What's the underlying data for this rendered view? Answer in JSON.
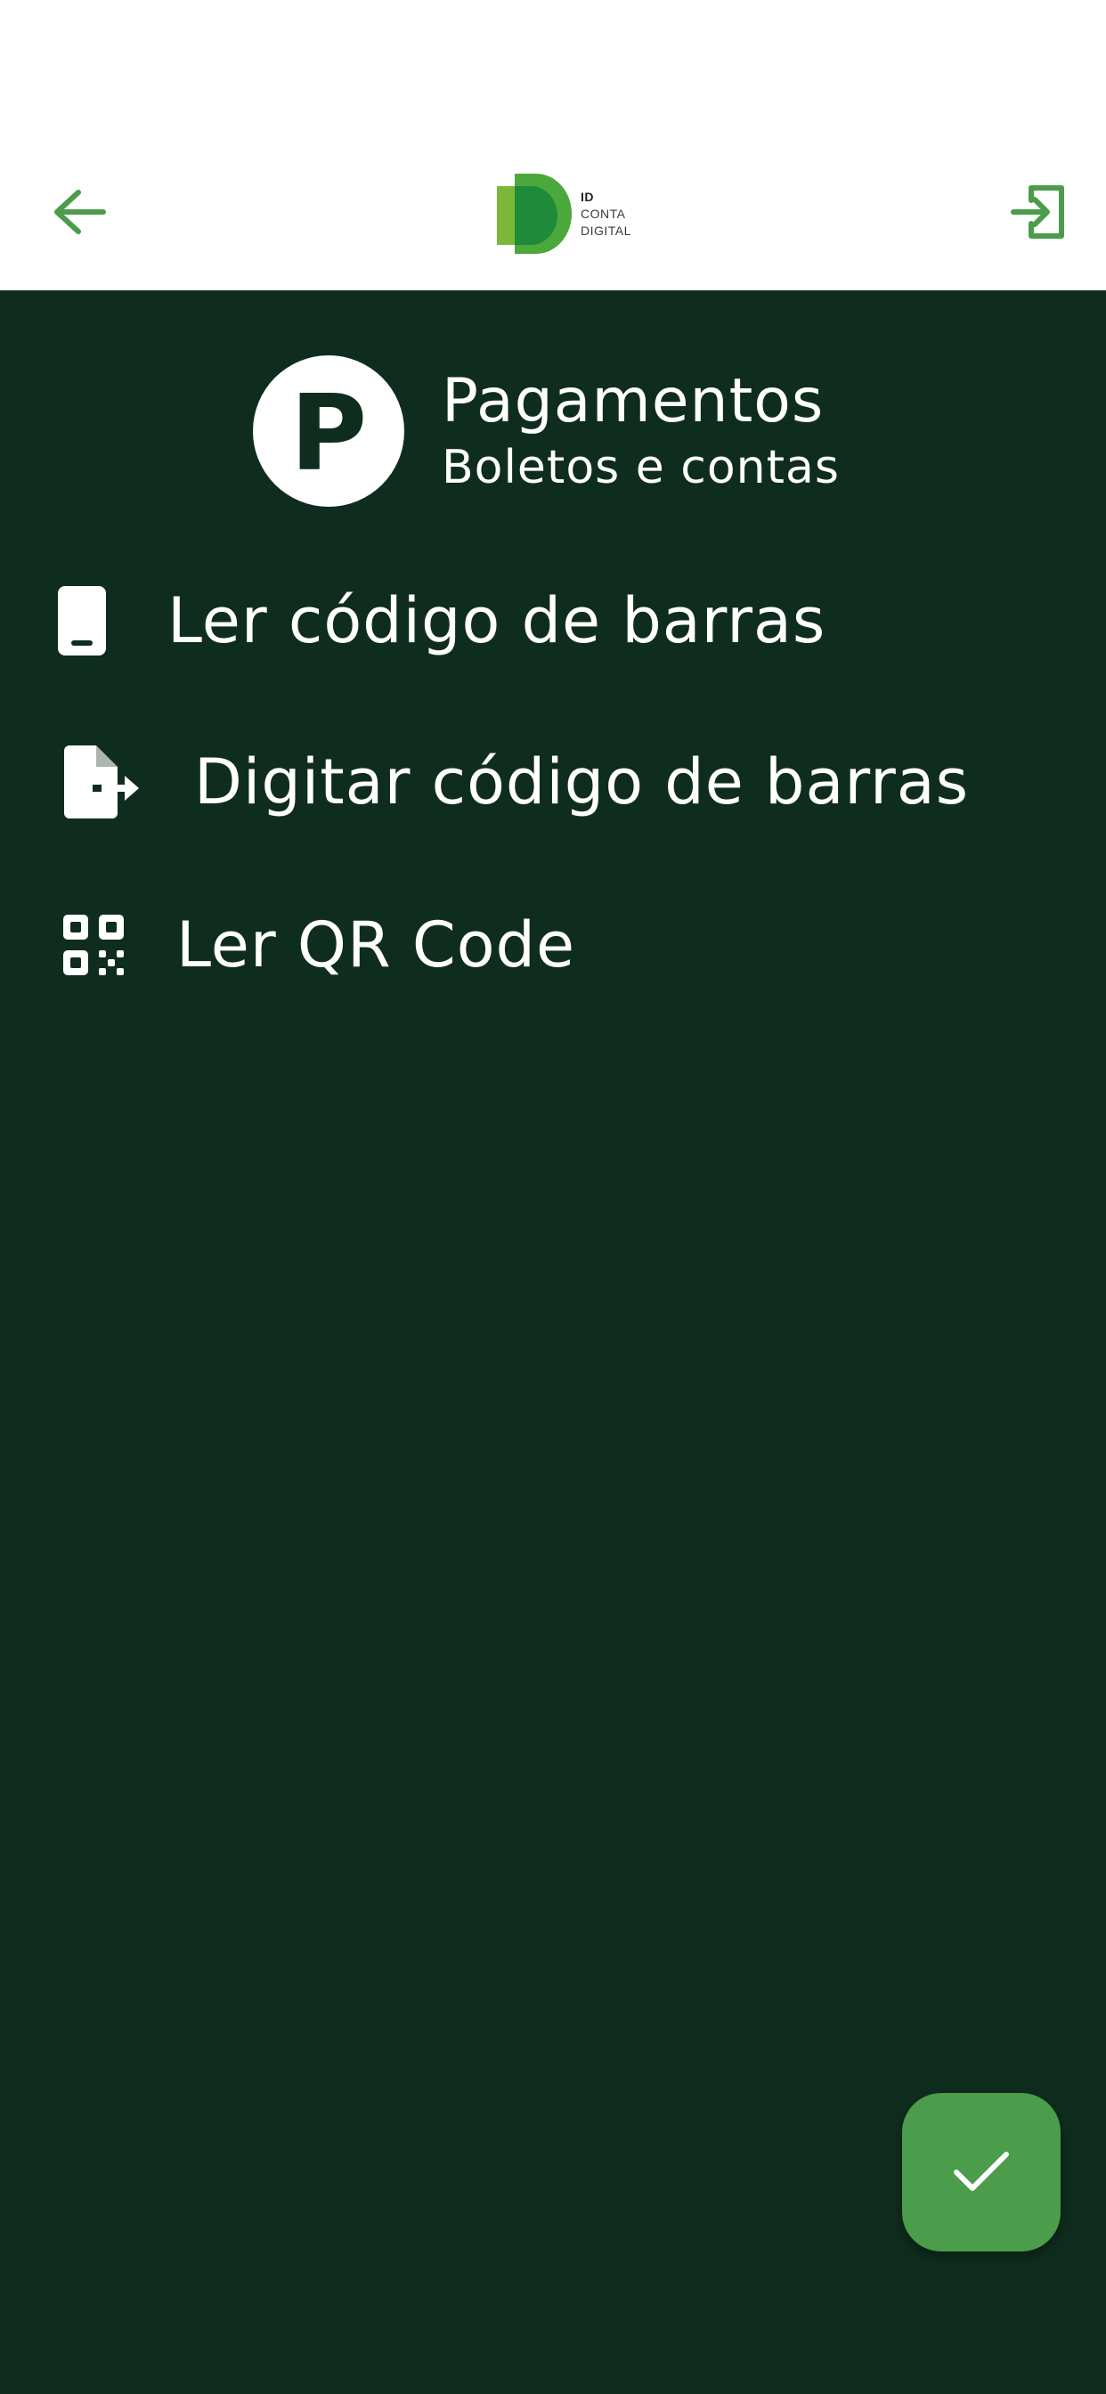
{
  "header": {
    "back_icon": "arrow-left-icon",
    "exit_icon": "login-exit-icon",
    "logo": {
      "line1": "ID",
      "line2": "CONTA",
      "line3": "DIGITAL"
    }
  },
  "section": {
    "avatar_letter": "P",
    "title": "Pagamentos",
    "subtitle": "Boletos e contas"
  },
  "menu": {
    "items": [
      {
        "label": "Ler código de barras",
        "icon": "smartphone-icon"
      },
      {
        "label": "Digitar código de barras",
        "icon": "file-export-icon"
      },
      {
        "label": "Ler QR Code",
        "icon": "qr-code-icon"
      }
    ]
  },
  "fab": {
    "icon": "check-icon"
  },
  "colors": {
    "background": "#0f2d1e",
    "header_bg": "#ffffff",
    "accent": "#4b9c4b",
    "logo_light_green": "#7bb83a",
    "logo_dark_green": "#1f8a3a",
    "text": "#ffffff"
  }
}
